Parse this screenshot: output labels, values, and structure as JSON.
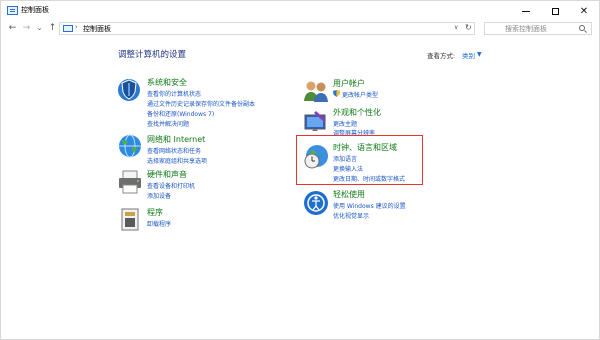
{
  "window": {
    "title": "控制面板"
  },
  "address": {
    "path": "控制面板",
    "search_placeholder": "搜索控制面板"
  },
  "content": {
    "heading": "调整计算机的设置",
    "view_by_label": "查看方式:",
    "view_by_value": "类别"
  },
  "categories": {
    "system": {
      "title": "系统和安全",
      "links": [
        "查看你的计算机状态",
        "通过文件历史记录保存你的文件备份副本",
        "备份和还原(Windows 7)",
        "查找并解决问题"
      ]
    },
    "network": {
      "title": "网络和 Internet",
      "links": [
        "查看网络状态和任务",
        "选择家庭组和共享选项"
      ]
    },
    "hardware": {
      "title": "硬件和声音",
      "links": [
        "查看设备和打印机",
        "添加设备"
      ]
    },
    "programs": {
      "title": "程序",
      "links": [
        "卸载程序"
      ]
    },
    "accounts": {
      "title": "用户帐户",
      "links": [
        "更改帐户类型"
      ]
    },
    "appearance": {
      "title": "外观和个性化",
      "links": [
        "更改主题",
        "调整屏幕分辨率"
      ]
    },
    "clock": {
      "title": "时钟、语言和区域",
      "links": [
        "添加语言",
        "更换输入法",
        "更改日期、时间或数字格式"
      ]
    },
    "ease": {
      "title": "轻松使用",
      "links": [
        "使用 Windows 建议的设置",
        "优化视觉显示"
      ]
    }
  },
  "colors": {
    "category_title": "#0d7a15",
    "link": "#1a56c7",
    "heading": "#1e3287",
    "highlight": "#e8332f"
  }
}
